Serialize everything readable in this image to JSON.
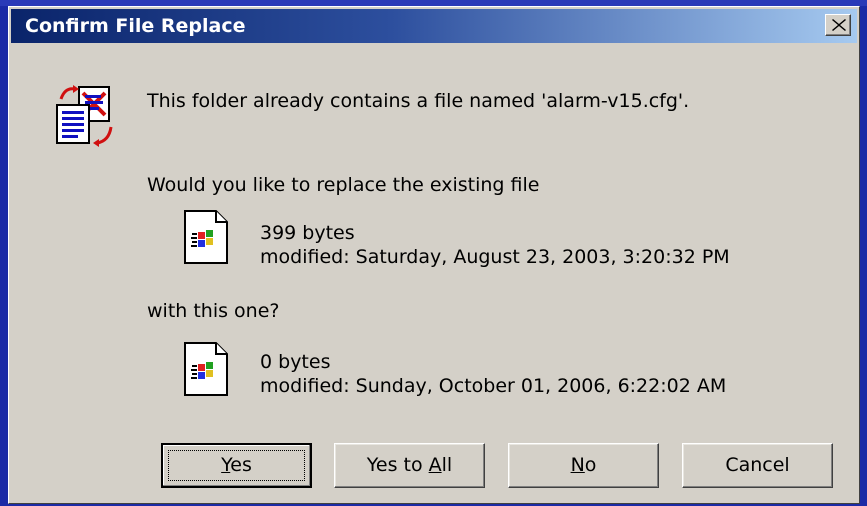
{
  "dialog": {
    "title": "Confirm File Replace",
    "message": "This folder already contains a file named 'alarm-v15.cfg'.",
    "question": "Would you like to replace the existing file",
    "with_text": "with this one?"
  },
  "existing_file": {
    "size": "399 bytes",
    "modified": "modified: Saturday, August 23, 2003, 3:20:32 PM"
  },
  "new_file": {
    "size": "0 bytes",
    "modified": "modified: Sunday, October 01, 2006, 6:22:02 AM"
  },
  "buttons": {
    "yes": {
      "pre": "",
      "key": "Y",
      "post": "es"
    },
    "yes_to_all": {
      "pre": "Yes to ",
      "key": "A",
      "post": "ll"
    },
    "no": {
      "pre": "",
      "key": "N",
      "post": "o"
    },
    "cancel": "Cancel"
  },
  "colors": {
    "desktop": "#1b2aa6",
    "title_start": "#0a246a",
    "title_end": "#a6caf0",
    "dialog_face": "#d4d0c8"
  },
  "icons": {
    "replace": "replace-file-icon",
    "file": "windows-file-icon",
    "close": "close-icon"
  }
}
